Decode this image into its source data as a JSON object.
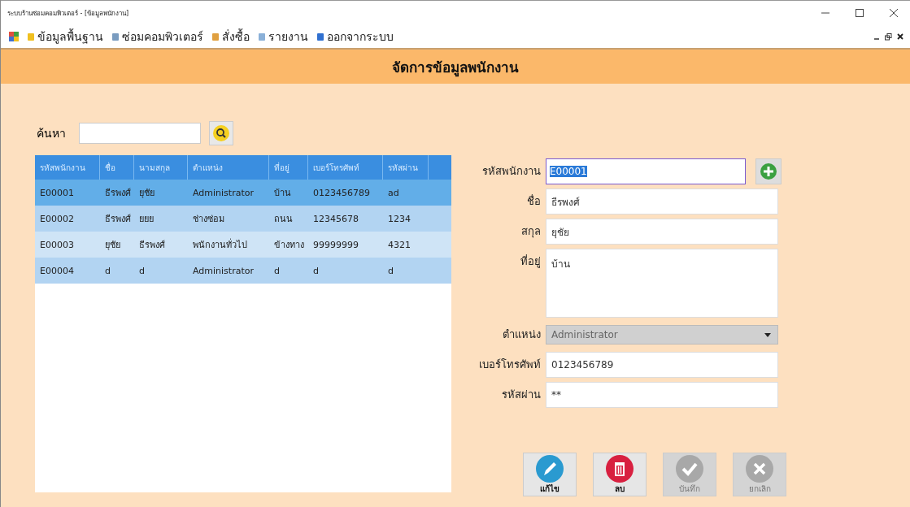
{
  "window": {
    "title": "ระบบร้านซ่อมคอมพิวเตอร์ - [ข้อมูลพนักงาน]"
  },
  "menu": [
    {
      "label": "ข้อมูลพื้นฐาน",
      "kind": "data"
    },
    {
      "label": "ซ่อมคอมพิวเตอร์",
      "kind": "repair"
    },
    {
      "label": "สั่งซื้อ",
      "kind": "order"
    },
    {
      "label": "รายงาน",
      "kind": "report"
    },
    {
      "label": "ออกจากระบบ",
      "kind": "logout"
    }
  ],
  "header": {
    "title": "จัดการข้อมูลพนักงาน"
  },
  "search": {
    "label": "ค้นหา"
  },
  "table": {
    "columns": [
      "รหัสพนักงาน",
      "ชื่อ",
      "นามสกุล",
      "ตำแหน่ง",
      "ที่อยู่",
      "เบอร์โทรศัพท์",
      "รหัสผ่าน"
    ],
    "rows": [
      {
        "selected": true,
        "cells": [
          "E00001",
          "ธีรพงศ์",
          "ยุชัย",
          "Administrator",
          "บ้าน",
          "0123456789",
          "ad"
        ]
      },
      {
        "selected": false,
        "cells": [
          "E00002",
          "ธีรพงศ์",
          "ยยย",
          "ช่างซ่อม",
          "ถนน",
          "12345678",
          "1234"
        ]
      },
      {
        "selected": false,
        "cells": [
          "E00003",
          "ยุชัย",
          "ธีรพงศ์",
          "พนักงานทั่วไป",
          "ข้างทาง",
          "99999999",
          "4321"
        ]
      },
      {
        "selected": false,
        "cells": [
          "E00004",
          "d",
          "d",
          "Administrator",
          "d",
          "d",
          "d"
        ]
      }
    ]
  },
  "form": [
    {
      "label": "รหัสพนักงาน",
      "value": "E00001",
      "kind": "id"
    },
    {
      "label": "ชื่อ",
      "value": "ธีรพงศ์",
      "kind": "text"
    },
    {
      "label": "สกุล",
      "value": "ยุชัย",
      "kind": "text"
    },
    {
      "label": "ที่อยู่",
      "value": "บ้าน",
      "kind": "area"
    },
    {
      "label": "ตำแหน่ง",
      "value": "Administrator",
      "kind": "select"
    },
    {
      "label": "เบอร์โทรศัพท์",
      "value": "0123456789",
      "kind": "text"
    },
    {
      "label": "รหัสผ่าน",
      "value": "**",
      "kind": "text"
    }
  ],
  "buttons": [
    {
      "label": "แก้ไข",
      "kind": "edit",
      "disabled": false
    },
    {
      "label": "ลบ",
      "kind": "delete",
      "disabled": false
    },
    {
      "label": "บันทึก",
      "kind": "save",
      "disabled": true
    },
    {
      "label": "ยกเลิก",
      "kind": "cancel",
      "disabled": true
    }
  ]
}
